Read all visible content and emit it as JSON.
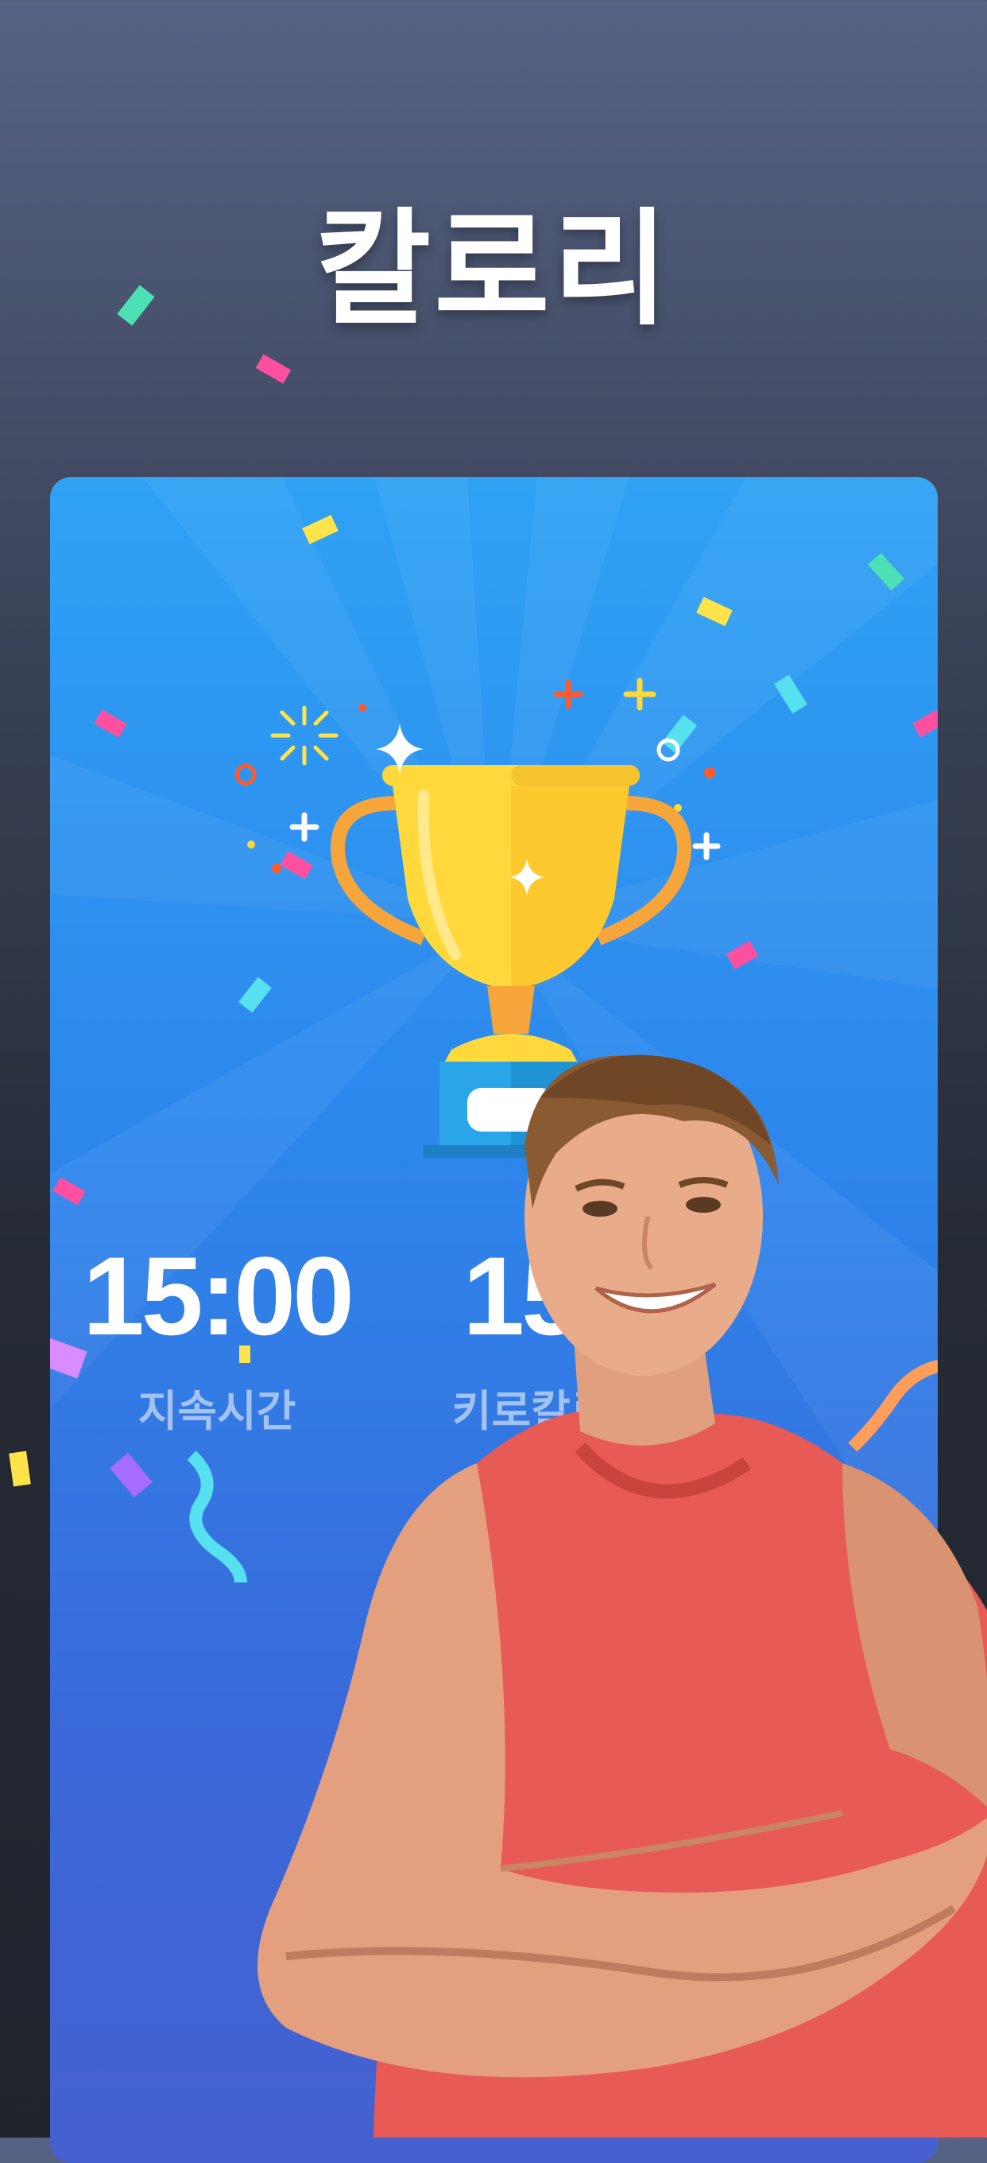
{
  "headline": "칼로리",
  "stats": {
    "duration": {
      "value": "15:00",
      "label": "지속시간"
    },
    "calories": {
      "value": "156",
      "label": "키로칼로리"
    }
  },
  "icons": [
    "trophy-icon",
    "sparkle-icon",
    "confetti"
  ],
  "colors": {
    "card_top": "#2fa2f4",
    "card_bottom": "#4660d0",
    "trophy_gold": "#ffd93b",
    "trophy_base": "#2aa6e8",
    "shirt": "#e85a55"
  }
}
